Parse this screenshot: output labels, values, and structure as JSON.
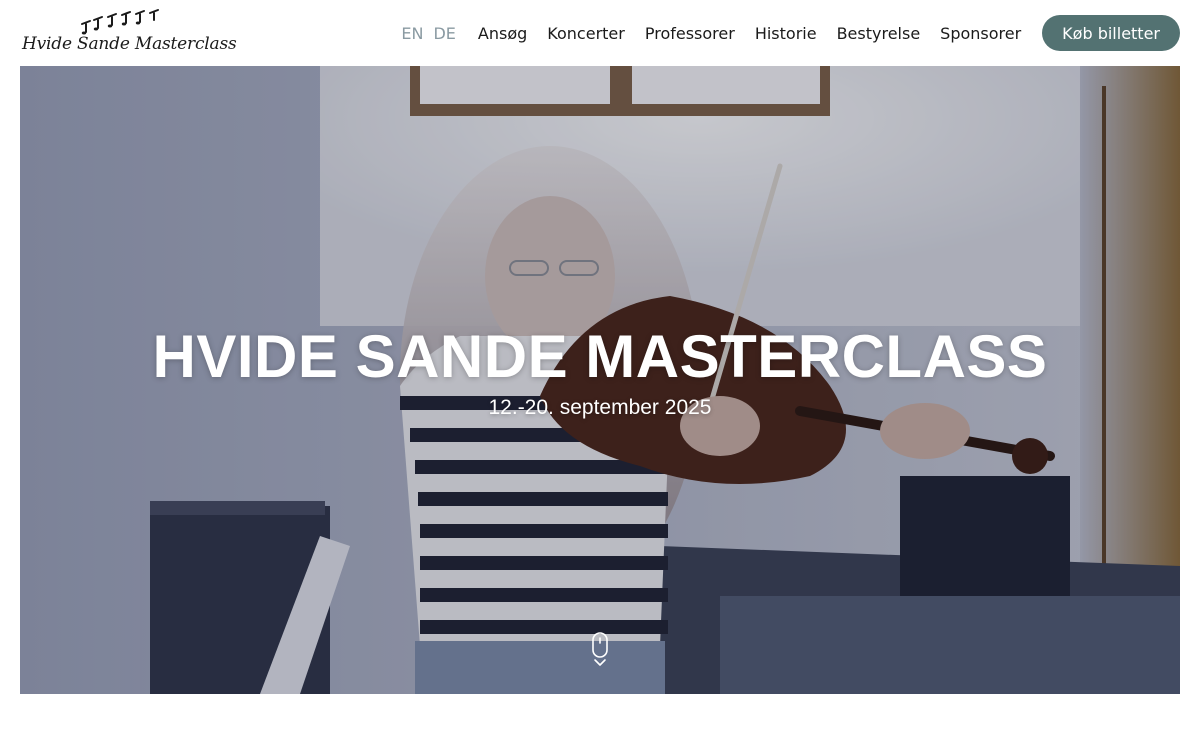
{
  "brand": {
    "logo_text": "Hvide Sande Masterclass"
  },
  "header": {
    "languages": [
      "EN",
      "DE"
    ],
    "nav": [
      "Ansøg",
      "Koncerter",
      "Professorer",
      "Historie",
      "Bestyrelse",
      "Sponsorer"
    ],
    "cta_label": "Køb billetter"
  },
  "hero": {
    "title": "HVIDE SANDE MASTERCLASS",
    "subtitle": "12.-20. september 2025"
  },
  "icons": {
    "logo_mark": "music-notes-icon",
    "scroll": "mouse-scroll-icon"
  },
  "colors": {
    "accent": "#537272",
    "language_inactive": "#8a9aa2",
    "text": "#1b1b1b",
    "hero_text": "#ffffff"
  }
}
